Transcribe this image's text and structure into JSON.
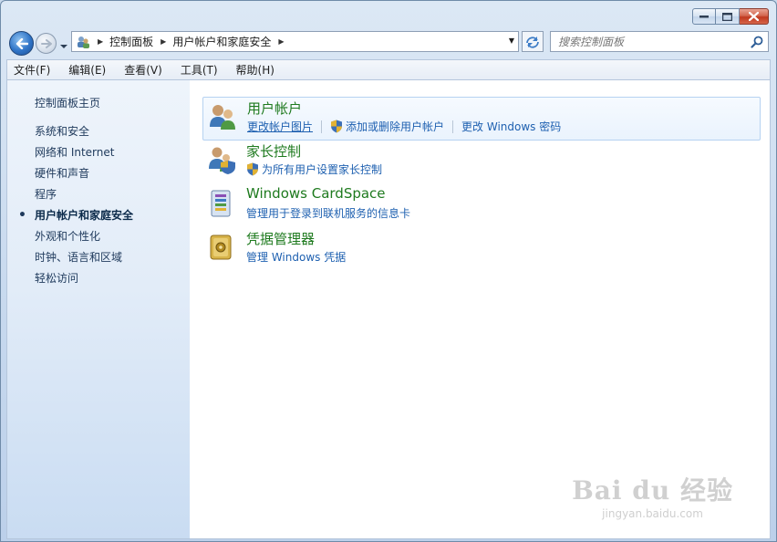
{
  "window": {
    "buttons": {
      "minimize": "minimize",
      "maximize": "maximize",
      "close": "close"
    }
  },
  "nav": {
    "breadcrumb": [
      "控制面板",
      "用户帐户和家庭安全"
    ],
    "search_placeholder": "搜索控制面板"
  },
  "menu": [
    "文件(F)",
    "编辑(E)",
    "查看(V)",
    "工具(T)",
    "帮助(H)"
  ],
  "sidebar": {
    "home": "控制面板主页",
    "items": [
      {
        "label": "系统和安全",
        "active": false
      },
      {
        "label": "网络和 Internet",
        "active": false
      },
      {
        "label": "硬件和声音",
        "active": false
      },
      {
        "label": "程序",
        "active": false
      },
      {
        "label": "用户帐户和家庭安全",
        "active": true
      },
      {
        "label": "外观和个性化",
        "active": false
      },
      {
        "label": "时钟、语言和区域",
        "active": false
      },
      {
        "label": "轻松访问",
        "active": false
      }
    ]
  },
  "categories": [
    {
      "title": "用户帐户",
      "icon": "user-accounts-icon",
      "links": [
        "更改帐户图片",
        "添加或删除用户帐户",
        "更改 Windows 密码"
      ]
    },
    {
      "title": "家长控制",
      "icon": "parental-controls-icon",
      "links": [
        "为所有用户设置家长控制"
      ]
    },
    {
      "title": "Windows CardSpace",
      "icon": "cardspace-icon",
      "links": [
        "管理用于登录到联机服务的信息卡"
      ]
    },
    {
      "title": "凭据管理器",
      "icon": "credential-manager-icon",
      "links": [
        "管理 Windows 凭据"
      ]
    }
  ],
  "watermark": {
    "brand": "Bai du 经验",
    "url": "jingyan.baidu.com"
  },
  "colors": {
    "link": "#1e60b0",
    "category_title": "#1e7a1e",
    "sidebar_text": "#1e395b"
  }
}
